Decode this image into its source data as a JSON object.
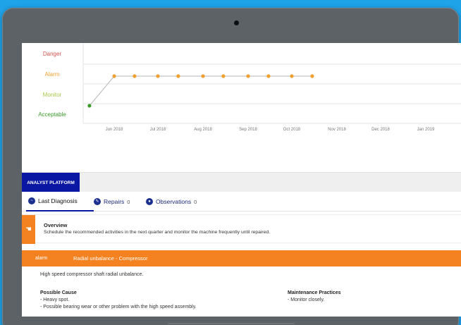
{
  "chart_data": {
    "type": "line",
    "y_categories": [
      "Acceptable",
      "Monitor",
      "Alarm",
      "Danger"
    ],
    "y_colors": {
      "Danger": "#d9534f",
      "Alarm": "#f0a030",
      "Monitor": "#a8c948",
      "Acceptable": "#3a9a2a"
    },
    "x_ticks": [
      "Jun 2018",
      "Jul 2018",
      "Aug 2018",
      "Sep 2018",
      "Oct 2018",
      "Nov 2018",
      "Dec 2018",
      "Jan 2019"
    ],
    "x_range": [
      "2018-05-01",
      "2019-01-31"
    ],
    "points": [
      {
        "date": "2018-05-15",
        "level": "Acceptable"
      },
      {
        "date": "2018-06-01",
        "level": "Alarm"
      },
      {
        "date": "2018-06-15",
        "level": "Alarm"
      },
      {
        "date": "2018-07-01",
        "level": "Alarm"
      },
      {
        "date": "2018-07-15",
        "level": "Alarm"
      },
      {
        "date": "2018-08-01",
        "level": "Alarm"
      },
      {
        "date": "2018-08-15",
        "level": "Alarm"
      },
      {
        "date": "2018-09-01",
        "level": "Alarm"
      },
      {
        "date": "2018-09-15",
        "level": "Alarm"
      },
      {
        "date": "2018-10-01",
        "level": "Alarm"
      },
      {
        "date": "2018-10-15",
        "level": "Alarm"
      }
    ],
    "grid": true
  },
  "platform": {
    "label": "ANALYST PLATFORM"
  },
  "tabs": [
    {
      "label": "Last Diagnosis",
      "count": ""
    },
    {
      "label": "Repairs",
      "count": "0"
    },
    {
      "label": "Observations",
      "count": "0"
    }
  ],
  "overview": {
    "title": "Overview",
    "text": "Schedule the recommended activities in the next quarter and monitor the machine frequently until repaired."
  },
  "diagnosis": {
    "severity": "alarm",
    "title": "Radial unbalance - Compressor",
    "description": "High speed compressor shaft radial unbalance.",
    "cause_title": "Possible Cause",
    "causes": [
      "- Heavy spot.",
      "- Possible bearing wear or other problem with the high speed assembly."
    ],
    "practices_title": "Maintenance Practices",
    "practices": [
      "- Monitor closely."
    ]
  },
  "colors": {
    "accent_orange": "#f58220",
    "platform_blue": "#0a17a3",
    "background": "#1fa3e8"
  }
}
